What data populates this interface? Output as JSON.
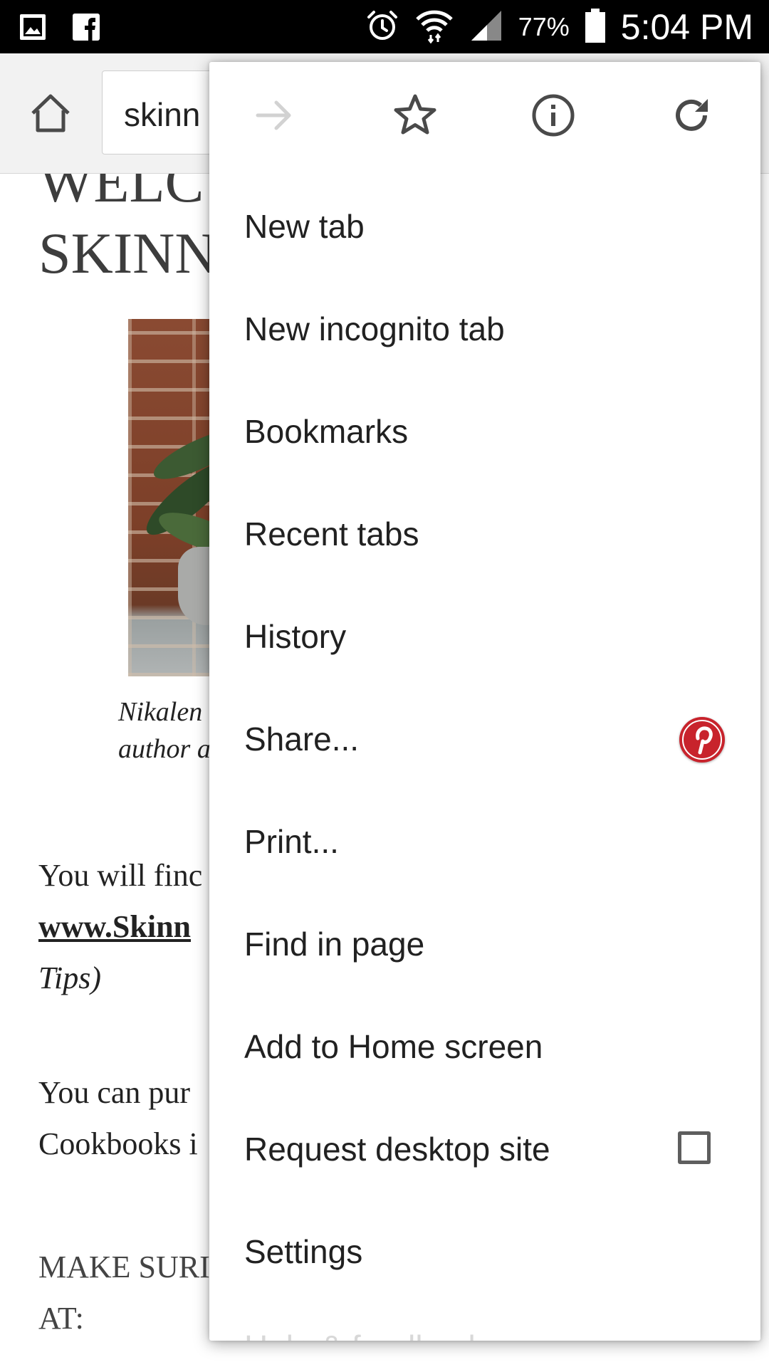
{
  "status_bar": {
    "battery_percent": "77%",
    "time": "5:04 PM",
    "icons": [
      "gallery-icon",
      "facebook-icon",
      "alarm-icon",
      "wifi-icon",
      "signal-icon",
      "battery-icon"
    ]
  },
  "toolbar": {
    "url": "skinn",
    "icons": [
      "home-icon"
    ]
  },
  "page": {
    "welcome_line1": "WELC",
    "welcome_line2": "SKINN",
    "caption_line1": "Nikalen",
    "caption_line2": "author a",
    "para1_line1": "You will finc",
    "para1_line2": "www.Skinn",
    "para1_line3": "Tips)",
    "para2_line1": "You can pur",
    "para2_line2": "Cookbooks i",
    "para3_line1": "MAKE SURI",
    "para3_line2": "AT:"
  },
  "menu": {
    "icon_row": [
      "forward-icon",
      "star-icon",
      "info-icon",
      "refresh-icon"
    ],
    "items": [
      {
        "label": "New tab"
      },
      {
        "label": "New incognito tab"
      },
      {
        "label": "Bookmarks"
      },
      {
        "label": "Recent tabs"
      },
      {
        "label": "History"
      },
      {
        "label": "Share..."
      },
      {
        "label": "Print..."
      },
      {
        "label": "Find in page"
      },
      {
        "label": "Add to Home screen"
      },
      {
        "label": "Request desktop site"
      },
      {
        "label": "Settings"
      },
      {
        "label": "Help & feedback"
      }
    ],
    "request_desktop_checked": false
  },
  "colors": {
    "status_bar": "#000000",
    "toolbar": "#f2f2f2",
    "pinterest": "#c8232c",
    "menu_text": "#212121"
  }
}
